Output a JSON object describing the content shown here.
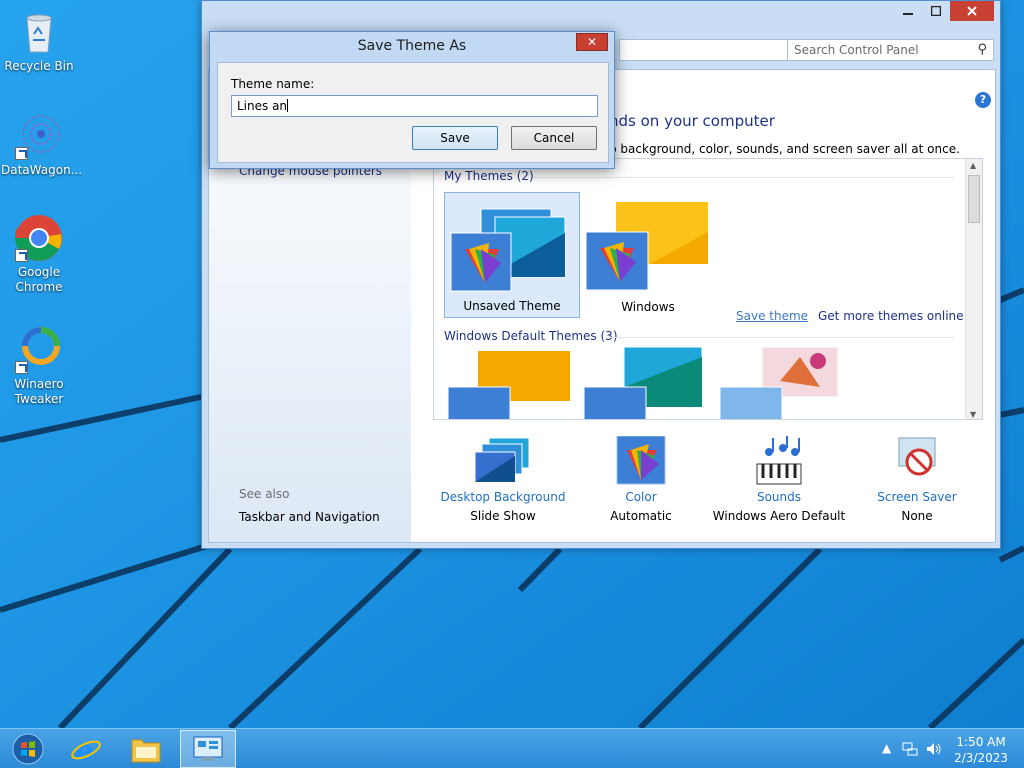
{
  "desktop": {
    "icons": [
      {
        "label": "Recycle Bin"
      },
      {
        "label": "DataWagon..."
      },
      {
        "label": "Google Chrome"
      },
      {
        "label": "Winaero Tweaker"
      }
    ]
  },
  "window": {
    "search_placeholder": "Search Control Panel",
    "left_pane": {
      "link_partial": "Change mouse pointers",
      "see_also": "See also",
      "taskbar_nav": "Taskbar and Navigation"
    },
    "heading": "nds on your computer",
    "subheading": "p background, color, sounds, and screen saver all at once.",
    "my_themes_label": "My Themes (2)",
    "themes": [
      {
        "label": "Unsaved Theme",
        "selected": true
      },
      {
        "label": "Windows",
        "selected": false
      }
    ],
    "save_theme_link": "Save theme",
    "more_themes_link": "Get more themes online",
    "default_themes_label": "Windows Default Themes (3)",
    "bottom": [
      {
        "link": "Desktop Background",
        "value": "Slide Show",
        "icon": "desktop-background-icon"
      },
      {
        "link": "Color",
        "value": "Automatic",
        "icon": "color-icon"
      },
      {
        "link": "Sounds",
        "value": "Windows Aero Default",
        "icon": "sounds-icon"
      },
      {
        "link": "Screen Saver",
        "value": "None",
        "icon": "screen-saver-icon"
      }
    ]
  },
  "dialog": {
    "title": "Save Theme As",
    "label": "Theme name:",
    "value": "Lines an",
    "save": "Save",
    "cancel": "Cancel"
  },
  "taskbar": {
    "time": "1:50 AM",
    "date": "2/3/2023"
  },
  "colors": {
    "accent": "#1e3287",
    "link": "#1e6fc2",
    "close": "#c84031"
  }
}
